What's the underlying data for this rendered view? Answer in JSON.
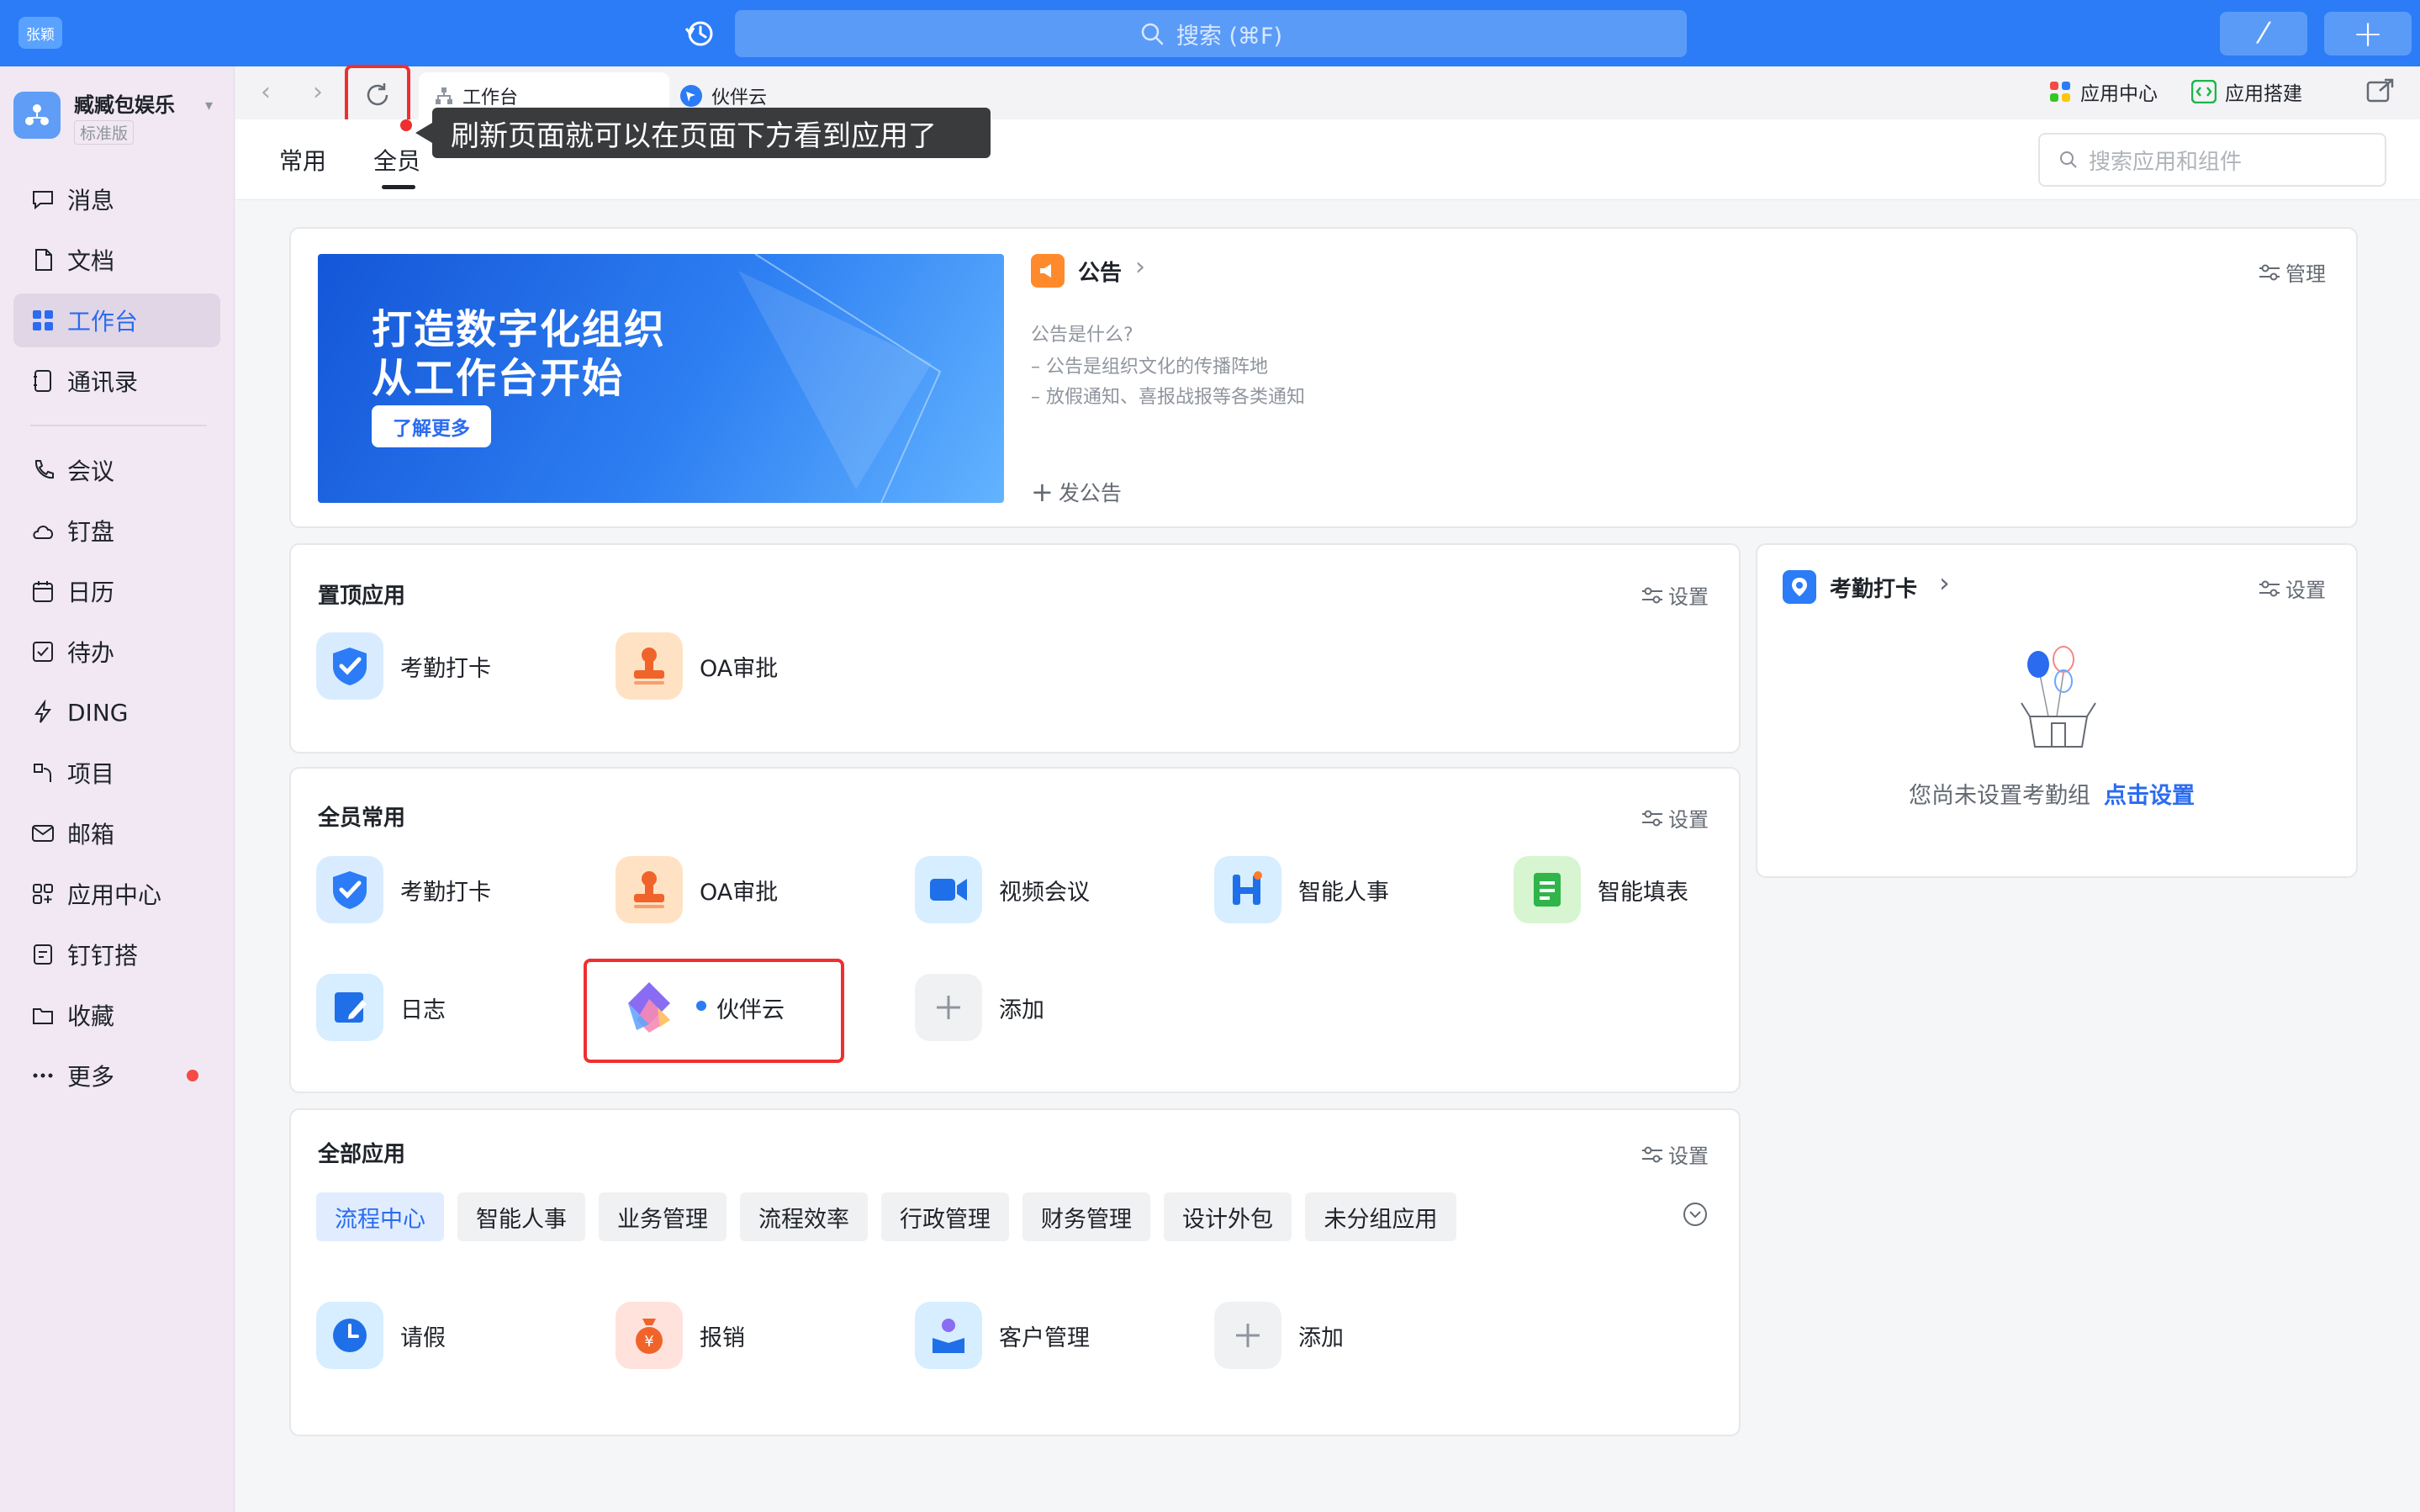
{
  "topbar": {
    "user": "张颖",
    "search_placeholder": "搜索 (⌘F)"
  },
  "org": {
    "name": "臧臧包娱乐",
    "edition": "标准版"
  },
  "sidebar": {
    "items": [
      {
        "label": "消息",
        "icon": "chat-bubble-icon"
      },
      {
        "label": "文档",
        "icon": "document-icon"
      },
      {
        "label": "工作台",
        "icon": "grid-icon"
      },
      {
        "label": "通讯录",
        "icon": "contacts-icon"
      },
      {
        "label": "会议",
        "icon": "phone-icon"
      },
      {
        "label": "钉盘",
        "icon": "cloud-icon"
      },
      {
        "label": "日历",
        "icon": "calendar-icon"
      },
      {
        "label": "待办",
        "icon": "todo-icon"
      },
      {
        "label": "DING",
        "icon": "lightning-icon"
      },
      {
        "label": "项目",
        "icon": "project-icon"
      },
      {
        "label": "邮箱",
        "icon": "mail-icon"
      },
      {
        "label": "应用中心",
        "icon": "apps-icon"
      },
      {
        "label": "钉钉搭",
        "icon": "builder-icon"
      },
      {
        "label": "收藏",
        "icon": "bookmark-icon"
      },
      {
        "label": "更多",
        "icon": "more-icon"
      }
    ]
  },
  "tabs": {
    "workbench": "工作台",
    "partner": "伙伴云"
  },
  "tooltip": "刷新页面就可以在页面下方看到应用了",
  "toplinks": {
    "app_center": "应用中心",
    "app_builder": "应用搭建"
  },
  "subnav": {
    "common": "常用",
    "all": "全员",
    "search_placeholder": "搜索应用和组件"
  },
  "banner": {
    "line1": "打造数字化组织",
    "line2": "从工作台开始",
    "button": "了解更多"
  },
  "announcement": {
    "title": "公告",
    "manage": "管理",
    "q": "公告是什么?",
    "l1": "– 公告是组织文化的传播阵地",
    "l2": "– 放假通知、喜报战报等各类通知",
    "post": "发公告"
  },
  "pinned": {
    "title": "置顶应用",
    "settings": "设置",
    "apps": [
      "考勤打卡",
      "OA审批"
    ]
  },
  "common_apps": {
    "title": "全员常用",
    "settings": "设置",
    "apps": [
      "考勤打卡",
      "OA审批",
      "视频会议",
      "智能人事",
      "智能填表",
      "日志",
      "伙伴云",
      "添加"
    ]
  },
  "all_apps": {
    "title": "全部应用",
    "settings": "设置",
    "categories": [
      "流程中心",
      "智能人事",
      "业务管理",
      "流程效率",
      "行政管理",
      "财务管理",
      "设计外包",
      "未分组应用"
    ],
    "apps": [
      "请假",
      "报销",
      "客户管理",
      "添加"
    ]
  },
  "attendance": {
    "title": "考勤打卡",
    "settings": "设置",
    "empty": "您尚未设置考勤组",
    "link": "点击设置"
  },
  "colors": {
    "accent": "#2b7cf6",
    "highlight": "#ef2f2f"
  }
}
